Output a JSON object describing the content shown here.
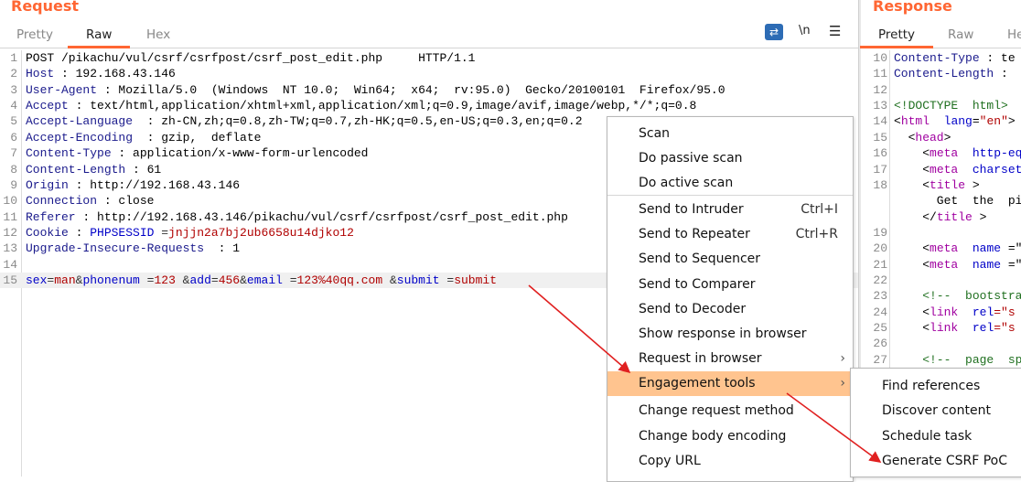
{
  "request": {
    "title": "Request",
    "tabs": [
      "Pretty",
      "Raw",
      "Hex"
    ],
    "active_tab": "Raw",
    "wrap_icon": "wrap-lines-icon",
    "newline_label": "\\n",
    "menu_icon": "hamburger-menu-icon",
    "lines": [
      [
        [
          "POST /pikachu/vul/csrf/csrfpost/csrf_post_edit.php     HTTP/1.1",
          "v"
        ]
      ],
      [
        [
          "Host",
          "k"
        ],
        [
          " : 192.168.43.146",
          "v"
        ]
      ],
      [
        [
          "User-Agent",
          "k"
        ],
        [
          " : Mozilla/5.0  (Windows  NT 10.0;  Win64;  x64;  rv:95.0)  Gecko/20100101  Firefox/95.0",
          "v"
        ]
      ],
      [
        [
          "Accept",
          "k"
        ],
        [
          " : text/html,application/xhtml+xml,application/xml;q=0.9,image/avif,image/webp,*/*;q=0.8",
          "v"
        ]
      ],
      [
        [
          "Accept-Language",
          "k"
        ],
        [
          "  : zh-CN,zh;q=0.8,zh-TW;q=0.7,zh-HK;q=0.5,en-US;q=0.3,en;q=0.2",
          "v"
        ]
      ],
      [
        [
          "Accept-Encoding",
          "k"
        ],
        [
          "  : gzip,  deflate",
          "v"
        ]
      ],
      [
        [
          "Content-Type",
          "k"
        ],
        [
          " : application/x-www-form-urlencoded",
          "v"
        ]
      ],
      [
        [
          "Content-Length",
          "k"
        ],
        [
          " : 61",
          "v"
        ]
      ],
      [
        [
          "Origin",
          "k"
        ],
        [
          " : http://192.168.43.146",
          "v"
        ]
      ],
      [
        [
          "Connection",
          "k"
        ],
        [
          " : close",
          "v"
        ]
      ],
      [
        [
          "Referer",
          "k"
        ],
        [
          " : http://192.168.43.146/pikachu/vul/csrf/csrfpost/csrf_post_edit.php",
          "v"
        ]
      ],
      [
        [
          "Cookie",
          "k"
        ],
        [
          " : ",
          "v"
        ],
        [
          "PHPSESSID",
          "pn"
        ],
        [
          " =",
          "p"
        ],
        [
          "jnjjn2a7bj2ub6658u14djko12",
          "pv"
        ]
      ],
      [
        [
          "Upgrade-Insecure-Requests",
          "k"
        ],
        [
          "  : 1",
          "v"
        ]
      ],
      [],
      [
        [
          "sex",
          "pn"
        ],
        [
          "=",
          "p"
        ],
        [
          "man",
          "pv"
        ],
        [
          "&",
          "p"
        ],
        [
          "phonenum",
          "pn"
        ],
        [
          " =",
          "p"
        ],
        [
          "123",
          "pv"
        ],
        [
          " &",
          "p"
        ],
        [
          "add",
          "pn"
        ],
        [
          "=",
          "p"
        ],
        [
          "456",
          "pv"
        ],
        [
          "&",
          "p"
        ],
        [
          "email",
          "pn"
        ],
        [
          " =",
          "p"
        ],
        [
          "123%40qq.com",
          "pv"
        ],
        [
          " &",
          "p"
        ],
        [
          "submit",
          "pn"
        ],
        [
          " =",
          "p"
        ],
        [
          "submit",
          "pv"
        ]
      ]
    ],
    "line_numbers": [
      "1",
      "2",
      "3",
      "4",
      "5",
      "6",
      "7",
      "8",
      "9",
      "10",
      "11",
      "12",
      "13",
      "14",
      "15"
    ]
  },
  "response": {
    "title": "Response",
    "tabs": [
      "Pretty",
      "Raw",
      "He"
    ],
    "active_tab": "Pretty",
    "line_numbers": [
      "10",
      "11",
      "12",
      "13",
      "14",
      "15",
      "16",
      "17",
      "18",
      "",
      "",
      "19",
      "20",
      "21",
      "22",
      "23",
      "24",
      "25",
      "26",
      "27"
    ],
    "lines": [
      [
        [
          "Content-Type",
          "k"
        ],
        [
          " : te",
          "v"
        ]
      ],
      [
        [
          "Content-Length",
          "k"
        ],
        [
          " :",
          "v"
        ]
      ],
      [],
      [
        [
          "<!DOCTYPE  html>",
          "cm"
        ]
      ],
      [
        [
          "<",
          "v"
        ],
        [
          "html",
          "tag"
        ],
        [
          "  ",
          "v"
        ],
        [
          "lang",
          "at"
        ],
        [
          "=",
          "v"
        ],
        [
          "\"en\"",
          "st"
        ],
        [
          ">",
          "v"
        ]
      ],
      [
        [
          "  <",
          "v"
        ],
        [
          "head",
          "tag"
        ],
        [
          ">",
          "v"
        ]
      ],
      [
        [
          "    <",
          "v"
        ],
        [
          "meta",
          "tag"
        ],
        [
          "  ",
          "v"
        ],
        [
          "http-eq",
          "at"
        ]
      ],
      [
        [
          "    <",
          "v"
        ],
        [
          "meta",
          "tag"
        ],
        [
          "  ",
          "v"
        ],
        [
          "charset",
          "at"
        ]
      ],
      [
        [
          "    <",
          "v"
        ],
        [
          "title",
          "tag"
        ],
        [
          " >",
          "v"
        ]
      ],
      [
        [
          "      Get  the  pi",
          "v"
        ]
      ],
      [
        [
          "    </",
          "v"
        ],
        [
          "title",
          "tag"
        ],
        [
          " >",
          "v"
        ]
      ],
      [],
      [
        [
          "    <",
          "v"
        ],
        [
          "meta",
          "tag"
        ],
        [
          "  ",
          "v"
        ],
        [
          "name",
          "at"
        ],
        [
          " =\"",
          "v"
        ]
      ],
      [
        [
          "    <",
          "v"
        ],
        [
          "meta",
          "tag"
        ],
        [
          "  ",
          "v"
        ],
        [
          "name",
          "at"
        ],
        [
          " =\"",
          "v"
        ]
      ],
      [],
      [
        [
          "    <!--  bootstra",
          "cm"
        ]
      ],
      [
        [
          "    <",
          "v"
        ],
        [
          "link",
          "tag"
        ],
        [
          "  ",
          "v"
        ],
        [
          "rel",
          "at"
        ],
        [
          "=\"s",
          "st"
        ]
      ],
      [
        [
          "    <",
          "v"
        ],
        [
          "link",
          "tag"
        ],
        [
          "  ",
          "v"
        ],
        [
          "rel",
          "at"
        ],
        [
          "=\"s",
          "st"
        ]
      ],
      [],
      [
        [
          "    <!--  page  spe",
          "cm"
        ]
      ]
    ]
  },
  "context_menu": {
    "items": [
      {
        "label": "Scan"
      },
      {
        "label": "Do passive scan"
      },
      {
        "label": "Do active scan"
      },
      {
        "label": "Send to Intruder",
        "shortcut": "Ctrl+I"
      },
      {
        "label": "Send to Repeater",
        "shortcut": "Ctrl+R"
      },
      {
        "label": "Send to Sequencer"
      },
      {
        "label": "Send to Comparer"
      },
      {
        "label": "Send to Decoder"
      },
      {
        "label": "Show response in browser"
      },
      {
        "label": "Request in browser",
        "submenu": true
      },
      {
        "label": "Engagement tools",
        "submenu": true,
        "active": true
      },
      {
        "label": "Change request method"
      },
      {
        "label": "Change body encoding"
      },
      {
        "label": "Copy URL"
      }
    ],
    "highlight_color": "#ffc48f"
  },
  "submenu": {
    "items": [
      {
        "label": "Find references"
      },
      {
        "label": "Discover content"
      },
      {
        "label": "Schedule task"
      },
      {
        "label": "Generate CSRF PoC"
      }
    ]
  },
  "annotation_color": "#e02020",
  "accent": "#ff6633"
}
